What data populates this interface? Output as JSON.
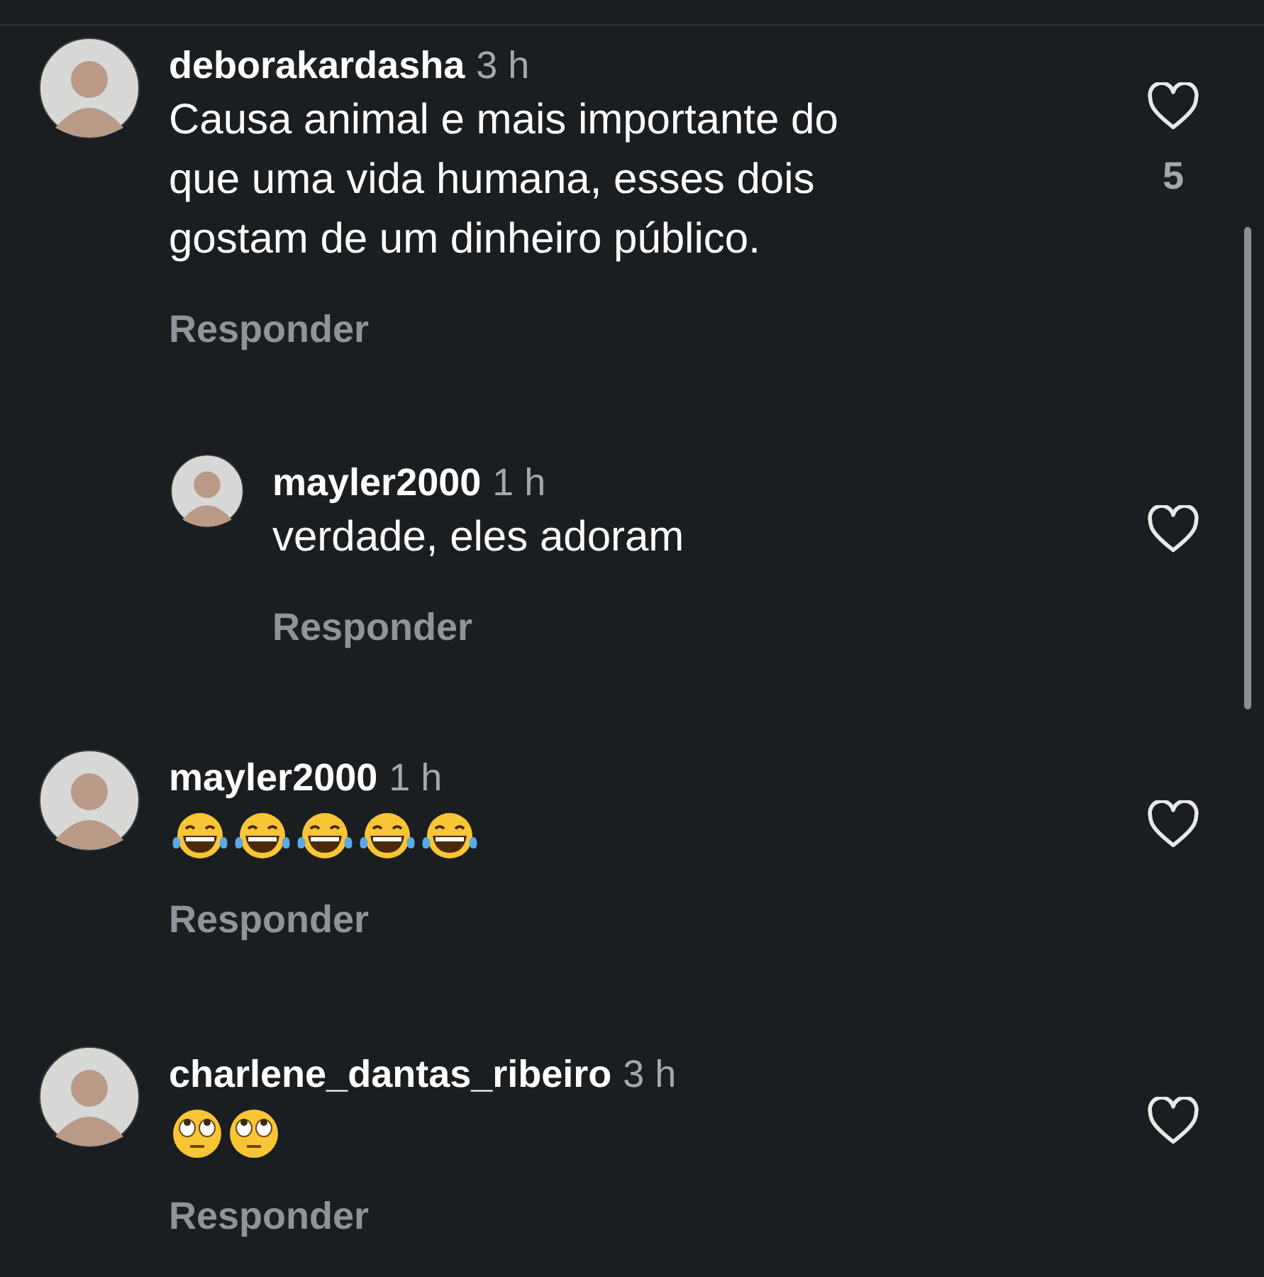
{
  "comments": [
    {
      "username": "deborakardasha",
      "time": "3 h",
      "text": [
        "Causa animal e mais importante do",
        "que uma vida humana, esses dois",
        "gostam de um dinheiro público."
      ],
      "reply_label": "Responder",
      "liked": false,
      "like_count": "5",
      "reply": false
    },
    {
      "username": "mayler2000",
      "time": "1 h",
      "text": [
        "verdade, eles adoram"
      ],
      "reply_label": "Responder",
      "liked": false,
      "reply": true
    },
    {
      "username": "mayler2000",
      "time": "1 h",
      "emojis": [
        {
          "kind": "laughing"
        },
        {
          "kind": "laughing"
        },
        {
          "kind": "laughing"
        },
        {
          "kind": "laughing"
        },
        {
          "kind": "laughing"
        }
      ],
      "reply_label": "Responder",
      "liked": false,
      "reply": false
    },
    {
      "username": "charlene_dantas_ribeiro",
      "time": "3 h",
      "emojis": [
        {
          "kind": "eyeroll"
        },
        {
          "kind": "eyeroll"
        }
      ],
      "reply_label": "Responder",
      "liked": false,
      "reply": false
    }
  ]
}
